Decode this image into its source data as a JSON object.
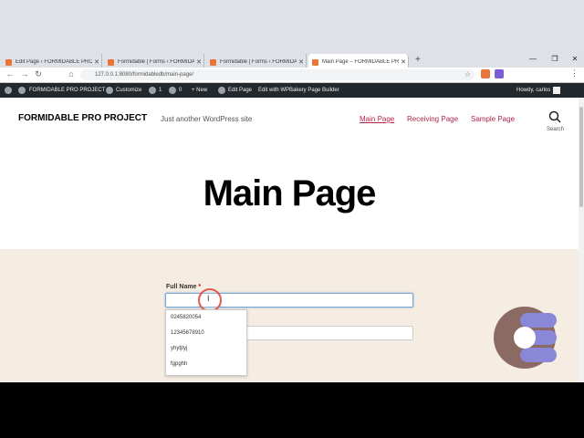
{
  "browser": {
    "tabs": [
      {
        "title": "Edit Page ‹ FORMIDABLE PRO PR",
        "active": false
      },
      {
        "title": "Formidable | Forms ‹ FORMIDABLE",
        "active": false
      },
      {
        "title": "Formidable | Forms ‹ FORMIDABLE",
        "active": false
      },
      {
        "title": "Main Page – FORMIDABLE PRO P",
        "active": true
      }
    ],
    "new_tab": "+",
    "url": "127.0.0.1:8080/formidabledb/main-page/"
  },
  "wp_admin_bar": {
    "site_name": "FORMIDABLE PRO PROJECT",
    "customize": "Customize",
    "updates_count": "1",
    "comments_count": "0",
    "new": "+ New",
    "edit_page": "Edit Page",
    "wpbakery": "Edit with WPBakery Page Builder",
    "howdy": "Howdy, carlos"
  },
  "site": {
    "title": "FORMIDABLE PRO PROJECT",
    "tagline": "Just another WordPress site",
    "menu": [
      "Main Page",
      "Receiving Page",
      "Sample Page"
    ],
    "search_label": "Search",
    "page_title": "Main Page"
  },
  "form": {
    "full_name_label": "Full Name",
    "required_mark": "*",
    "autocomplete_options": [
      "0245820054",
      "12345678910",
      "yhytjtyj",
      "fgpghh"
    ]
  },
  "colors": {
    "menu_link": "#b0254b",
    "form_bg": "#f5ede2",
    "admin_bar": "#23282d",
    "focus_border": "#7aa7d6"
  }
}
